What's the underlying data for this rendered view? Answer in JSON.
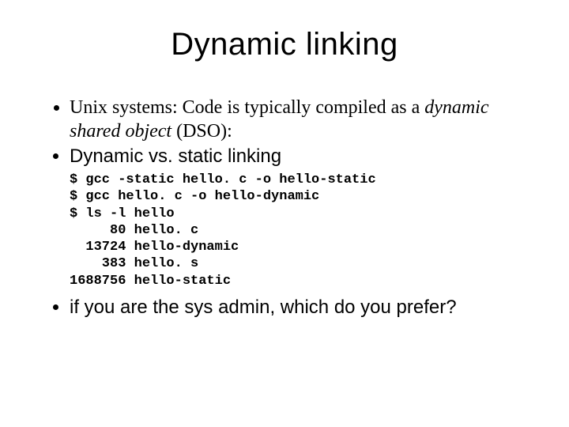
{
  "title": "Dynamic linking",
  "bullet1_prefix": "Unix systems: Code is typically compiled as a ",
  "bullet1_em": "dynamic shared object",
  "bullet1_suffix": " (DSO):",
  "bullet2": "Dynamic vs. static linking",
  "code": "$ gcc -static hello. c -o hello-static\n$ gcc hello. c -o hello-dynamic\n$ ls -l hello\n     80 hello. c\n  13724 hello-dynamic\n    383 hello. s\n1688756 hello-static",
  "bullet3": "if you are the sys admin, which do you prefer?"
}
